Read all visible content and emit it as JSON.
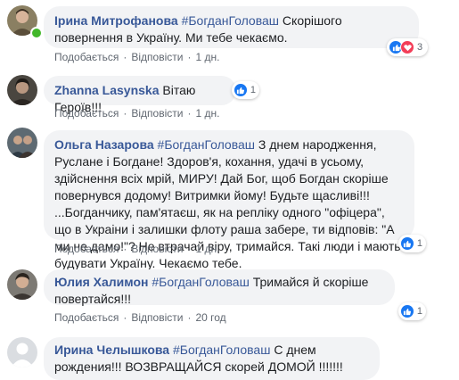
{
  "comments": [
    {
      "author": "Ірина Митрофанова",
      "hashtag": "#БогданГоловаш",
      "text": "Скорішого повернення в Україну. Ми тебе чекаємо.",
      "reaction_count": "3",
      "time": "1 дн."
    },
    {
      "author": "Zhanna Lasynska",
      "hashtag": "",
      "text": "Вітаю Героїв!!!",
      "reaction_count": "1",
      "time": "1 дн."
    },
    {
      "author": "Ольга Назарова",
      "hashtag": "#БогданГоловаш",
      "text": "З днем народження, Руслане і Богдане! Здоров'я, кохання, удачі в усьому, здійснення всіх мрій, МИРУ! Дай Бог, щоб Богдан скоріше повернувся додому! Витримки йому! Будьте щасливі!!! ...Богданчику, пам'ятаєш, як на репліку одного \"офіцера\", що в Украіни і залишки флоту раша забере, ти відповів: \"А ми не дамо!\"? Не втрачай віру, тримайся. Такі люди і мають будувати Україну. Чекаємо тебе.",
      "reaction_count": "1",
      "time": "1 дн."
    },
    {
      "author": "Юлия Халимон",
      "hashtag": "#БогданГоловаш",
      "text": "Тримайся й скоріше повертайся!!!",
      "reaction_count": "1",
      "time": "20 год"
    },
    {
      "author": "Ирина Челышкова",
      "hashtag": "#БогданГоловаш",
      "text": "С днем рождения!!! ВОЗВРАЩАЙСЯ скорей ДОМОЙ !!!!!!!",
      "reaction_count": "",
      "time": ""
    }
  ],
  "actions": {
    "like": "Подобається",
    "reply": "Відповісти",
    "separator": "·"
  },
  "colors": {
    "link": "#385898",
    "bubble": "#f2f3f5",
    "like": "#1877f2",
    "love": "#f33e58",
    "online": "#42b72a"
  }
}
